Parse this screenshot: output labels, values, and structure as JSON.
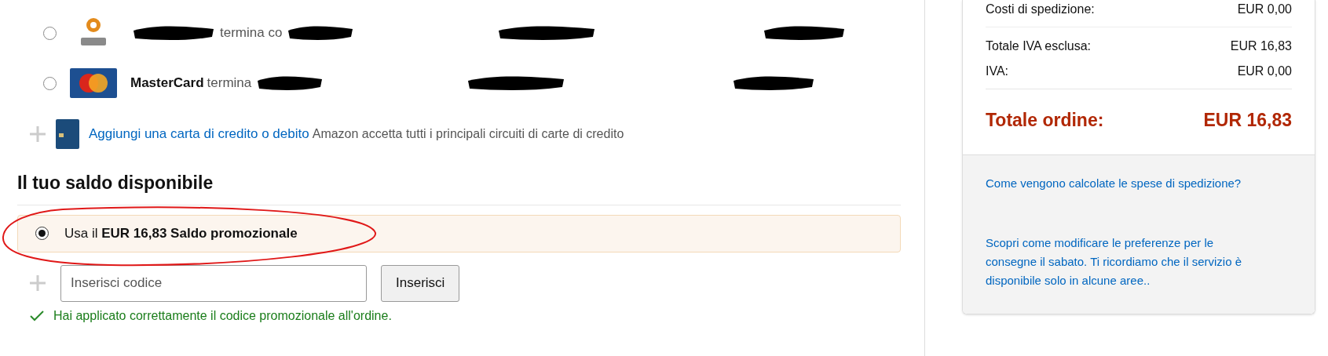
{
  "payment_methods": [
    {
      "kind": "cartasi",
      "selected": false,
      "suffix": "termina co"
    },
    {
      "kind": "mastercard",
      "selected": false,
      "name": "MasterCard",
      "suffix": "termina"
    }
  ],
  "add_card": {
    "link": "Aggiungi una carta di credito o debito",
    "note": "Amazon accetta tutti i principali circuiti di carte di credito"
  },
  "balance": {
    "heading": "Il tuo saldo disponibile",
    "option": {
      "selected": true,
      "text": "Usa il **EUR 16,83 Saldo promozionale**"
    },
    "code_field": {
      "placeholder": "Inserisci codice"
    },
    "apply_button": "Inserisci",
    "success": "Hai applicato correttamente il codice promozionale all'ordine."
  },
  "summary": {
    "rows": [
      {
        "label": "Costi di spedizione:",
        "value": "EUR 0,00"
      },
      {
        "label": "Totale IVA esclusa:",
        "value": "EUR 16,83"
      },
      {
        "label": "IVA:",
        "value": "EUR 0,00"
      }
    ],
    "total": {
      "label": "Totale ordine:",
      "value": "EUR 16,83"
    },
    "links": [
      "Come vengono calcolate le spese di spedizione?",
      "Scopri come modificare le preferenze per le consegne il sabato. Ti ricordiamo che il servizio è disponibile solo in alcune aree.."
    ]
  }
}
